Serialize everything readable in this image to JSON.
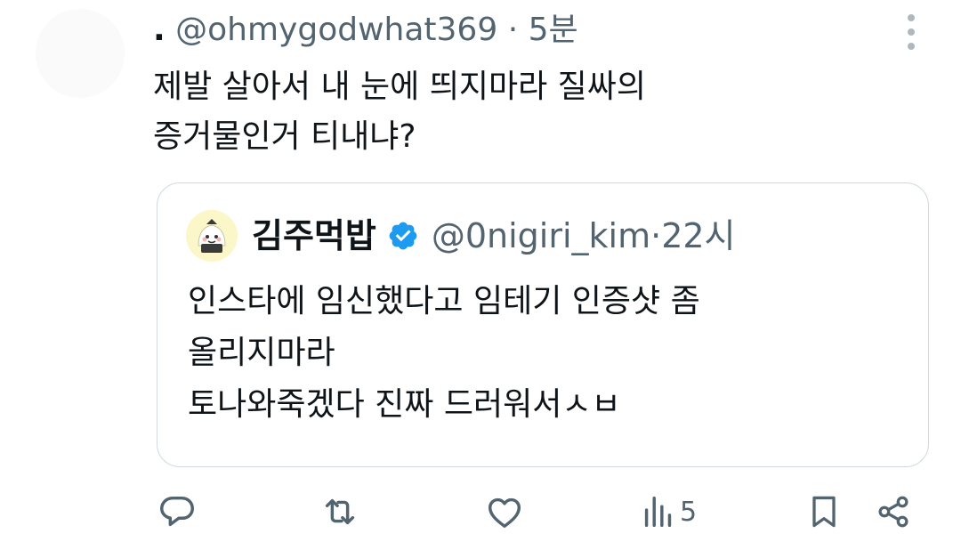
{
  "tweet": {
    "name": ".",
    "handle": "@ohmygodwhat369",
    "separator": "·",
    "time": "5분",
    "text_lines": [
      "제발 살아서 내 눈에 띄지마라 질싸의",
      "증거물인거 티내냐?"
    ]
  },
  "quote": {
    "name": "김주먹밥",
    "handle": "@0nigiri_kim",
    "separator": "·",
    "time": "22시",
    "text_lines": [
      "인스타에 임신했다고 임테기 인증샷 좀",
      "올리지마라",
      "토나와죽겠다 진짜 드러워서ㅅㅂ"
    ]
  },
  "actions": {
    "views": "5"
  },
  "icons": [
    "more-icon",
    "verified-badge-icon",
    "reply-icon",
    "retweet-icon",
    "like-icon",
    "views-icon",
    "bookmark-icon",
    "share-icon"
  ],
  "colors": {
    "text": "#0f1419",
    "muted": "#536471",
    "verified": "#1d9bf0",
    "border": "#cfd9de"
  }
}
